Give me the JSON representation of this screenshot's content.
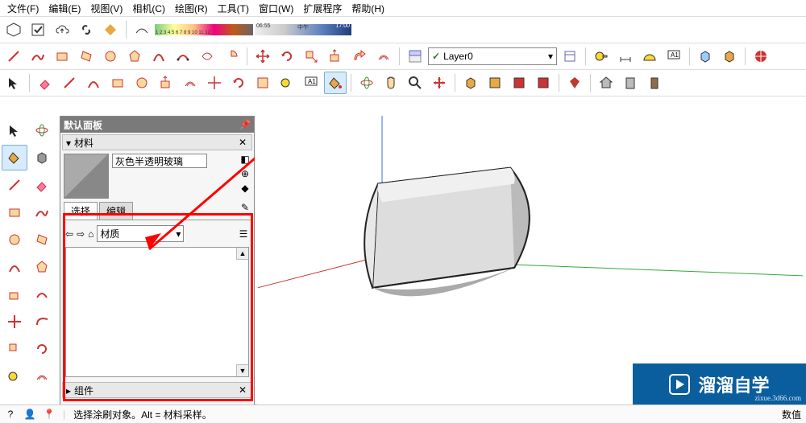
{
  "menu": [
    "文件(F)",
    "编辑(E)",
    "视图(V)",
    "相机(C)",
    "绘图(R)",
    "工具(T)",
    "窗口(W)",
    "扩展程序",
    "帮助(H)"
  ],
  "time_labels": {
    "left": "06:55",
    "mid": "中午",
    "right": "17:00"
  },
  "gradient_nums": "1 2 3 4 5 6 7 8 9 10 11 12",
  "layer": {
    "check": "✓",
    "name": "Layer0"
  },
  "panel": {
    "title": "默认面板",
    "materials_hdr": "材料",
    "material_name": "灰色半透明玻璃",
    "tabs": {
      "select": "选择",
      "edit": "编辑"
    },
    "category": "材质",
    "components_hdr": "组件"
  },
  "status": {
    "hint": "选择涂刷对象。Alt = 材料采样。",
    "value_label": "数值"
  },
  "watermark": {
    "main": "溜溜自学",
    "sub": "zixue.3d66.com"
  }
}
